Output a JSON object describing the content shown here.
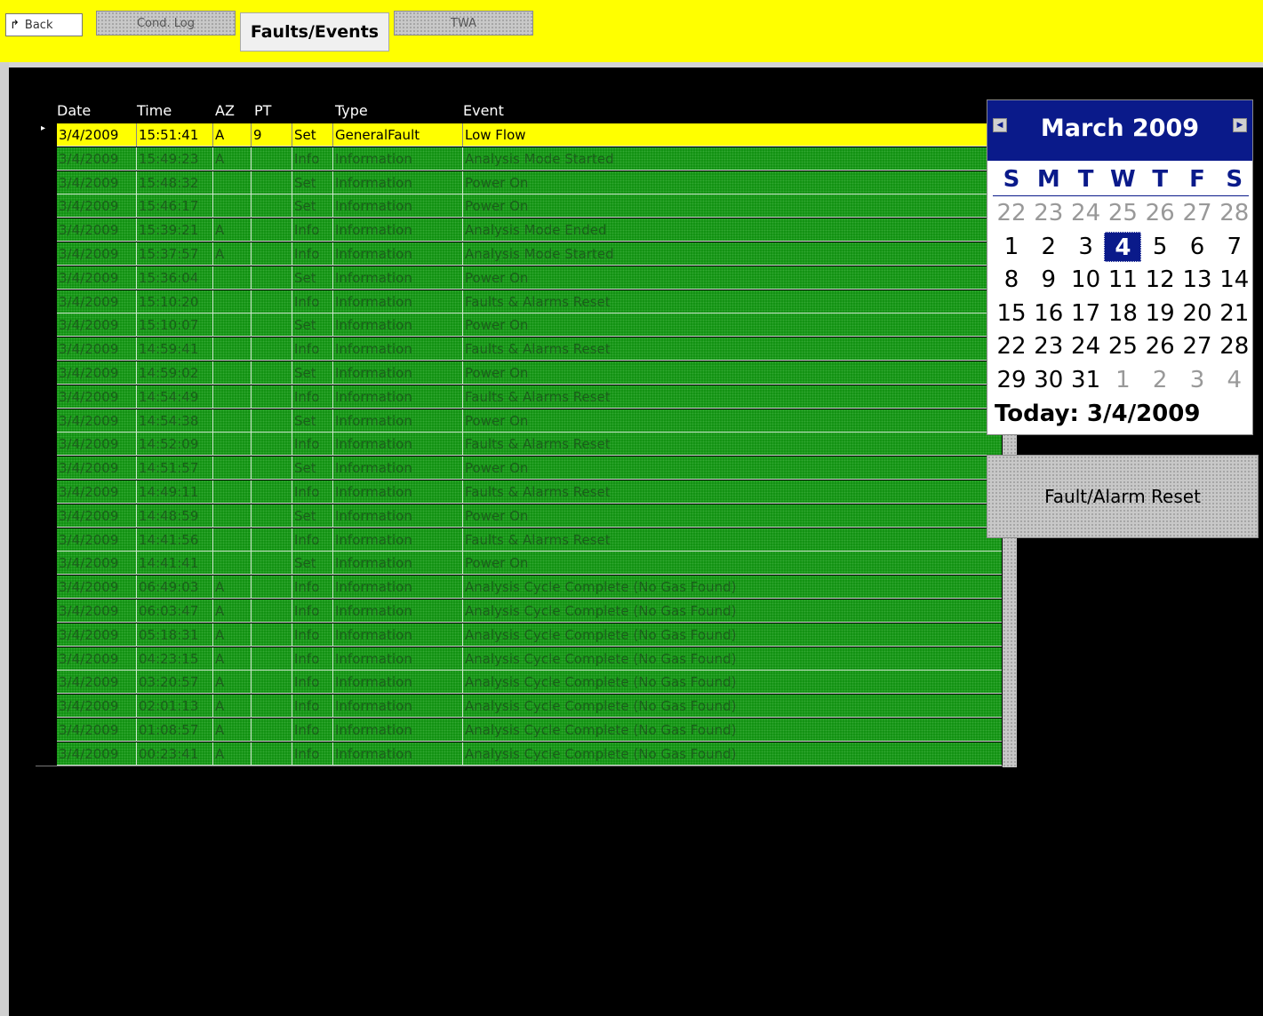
{
  "toolbar": {
    "back_label": "Back",
    "tabs": [
      {
        "label": "Cond. Log",
        "active": false
      },
      {
        "label": "Faults/Events",
        "active": true
      },
      {
        "label": "TWA",
        "active": false
      }
    ]
  },
  "grid": {
    "columns": [
      "Date",
      "Time",
      "AZ",
      "PT",
      "",
      "Type",
      "Event"
    ],
    "rows": [
      {
        "date": "3/4/2009",
        "time": "15:51:41",
        "az": "A",
        "pt": "9",
        "set": "Set",
        "type": "GeneralFault",
        "event": "Low Flow",
        "selected": true
      },
      {
        "date": "3/4/2009",
        "time": "15:49:23",
        "az": "A",
        "pt": "",
        "set": "Info",
        "type": "Information",
        "event": "Analysis Mode Started"
      },
      {
        "date": "3/4/2009",
        "time": "15:48:32",
        "az": "",
        "pt": "",
        "set": "Set",
        "type": "Information",
        "event": "Power On"
      },
      {
        "date": "3/4/2009",
        "time": "15:46:17",
        "az": "",
        "pt": "",
        "set": "Set",
        "type": "Information",
        "event": "Power On"
      },
      {
        "date": "3/4/2009",
        "time": "15:39:21",
        "az": "A",
        "pt": "",
        "set": "Info",
        "type": "Information",
        "event": "Analysis Mode Ended"
      },
      {
        "date": "3/4/2009",
        "time": "15:37:57",
        "az": "A",
        "pt": "",
        "set": "Info",
        "type": "Information",
        "event": "Analysis Mode Started"
      },
      {
        "date": "3/4/2009",
        "time": "15:36:04",
        "az": "",
        "pt": "",
        "set": "Set",
        "type": "Information",
        "event": "Power On"
      },
      {
        "date": "3/4/2009",
        "time": "15:10:20",
        "az": "",
        "pt": "",
        "set": "Info",
        "type": "Information",
        "event": "Faults & Alarms Reset"
      },
      {
        "date": "3/4/2009",
        "time": "15:10:07",
        "az": "",
        "pt": "",
        "set": "Set",
        "type": "Information",
        "event": "Power On"
      },
      {
        "date": "3/4/2009",
        "time": "14:59:41",
        "az": "",
        "pt": "",
        "set": "Info",
        "type": "Information",
        "event": "Faults & Alarms Reset"
      },
      {
        "date": "3/4/2009",
        "time": "14:59:02",
        "az": "",
        "pt": "",
        "set": "Set",
        "type": "Information",
        "event": "Power On"
      },
      {
        "date": "3/4/2009",
        "time": "14:54:49",
        "az": "",
        "pt": "",
        "set": "Info",
        "type": "Information",
        "event": "Faults & Alarms Reset"
      },
      {
        "date": "3/4/2009",
        "time": "14:54:38",
        "az": "",
        "pt": "",
        "set": "Set",
        "type": "Information",
        "event": "Power On"
      },
      {
        "date": "3/4/2009",
        "time": "14:52:09",
        "az": "",
        "pt": "",
        "set": "Info",
        "type": "Information",
        "event": "Faults & Alarms Reset"
      },
      {
        "date": "3/4/2009",
        "time": "14:51:57",
        "az": "",
        "pt": "",
        "set": "Set",
        "type": "Information",
        "event": "Power On"
      },
      {
        "date": "3/4/2009",
        "time": "14:49:11",
        "az": "",
        "pt": "",
        "set": "Info",
        "type": "Information",
        "event": "Faults & Alarms Reset"
      },
      {
        "date": "3/4/2009",
        "time": "14:48:59",
        "az": "",
        "pt": "",
        "set": "Set",
        "type": "Information",
        "event": "Power On"
      },
      {
        "date": "3/4/2009",
        "time": "14:41:56",
        "az": "",
        "pt": "",
        "set": "Info",
        "type": "Information",
        "event": "Faults & Alarms Reset"
      },
      {
        "date": "3/4/2009",
        "time": "14:41:41",
        "az": "",
        "pt": "",
        "set": "Set",
        "type": "Information",
        "event": "Power On"
      },
      {
        "date": "3/4/2009",
        "time": "06:49:03",
        "az": "A",
        "pt": "",
        "set": "Info",
        "type": "Information",
        "event": "Analysis Cycle Complete (No Gas Found)"
      },
      {
        "date": "3/4/2009",
        "time": "06:03:47",
        "az": "A",
        "pt": "",
        "set": "Info",
        "type": "Information",
        "event": "Analysis Cycle Complete (No Gas Found)"
      },
      {
        "date": "3/4/2009",
        "time": "05:18:31",
        "az": "A",
        "pt": "",
        "set": "Info",
        "type": "Information",
        "event": "Analysis Cycle Complete (No Gas Found)"
      },
      {
        "date": "3/4/2009",
        "time": "04:23:15",
        "az": "A",
        "pt": "",
        "set": "Info",
        "type": "Information",
        "event": "Analysis Cycle Complete (No Gas Found)"
      },
      {
        "date": "3/4/2009",
        "time": "03:20:57",
        "az": "A",
        "pt": "",
        "set": "Info",
        "type": "Information",
        "event": "Analysis Cycle Complete (No Gas Found)"
      },
      {
        "date": "3/4/2009",
        "time": "02:01:13",
        "az": "A",
        "pt": "",
        "set": "Info",
        "type": "Information",
        "event": "Analysis Cycle Complete (No Gas Found)"
      },
      {
        "date": "3/4/2009",
        "time": "01:08:57",
        "az": "A",
        "pt": "",
        "set": "Info",
        "type": "Information",
        "event": "Analysis Cycle Complete (No Gas Found)"
      },
      {
        "date": "3/4/2009",
        "time": "00:23:41",
        "az": "A",
        "pt": "",
        "set": "Info",
        "type": "Information",
        "event": "Analysis Cycle Complete (No Gas Found)"
      }
    ]
  },
  "calendar": {
    "title": "March 2009",
    "days_of_week": [
      "S",
      "M",
      "T",
      "W",
      "T",
      "F",
      "S"
    ],
    "weeks": [
      [
        {
          "d": "22",
          "o": true
        },
        {
          "d": "23",
          "o": true
        },
        {
          "d": "24",
          "o": true
        },
        {
          "d": "25",
          "o": true
        },
        {
          "d": "26",
          "o": true
        },
        {
          "d": "27",
          "o": true
        },
        {
          "d": "28",
          "o": true
        }
      ],
      [
        {
          "d": "1"
        },
        {
          "d": "2"
        },
        {
          "d": "3"
        },
        {
          "d": "4",
          "today": true
        },
        {
          "d": "5"
        },
        {
          "d": "6"
        },
        {
          "d": "7"
        }
      ],
      [
        {
          "d": "8"
        },
        {
          "d": "9"
        },
        {
          "d": "10"
        },
        {
          "d": "11"
        },
        {
          "d": "12"
        },
        {
          "d": "13"
        },
        {
          "d": "14"
        }
      ],
      [
        {
          "d": "15"
        },
        {
          "d": "16"
        },
        {
          "d": "17"
        },
        {
          "d": "18"
        },
        {
          "d": "19"
        },
        {
          "d": "20"
        },
        {
          "d": "21"
        }
      ],
      [
        {
          "d": "22"
        },
        {
          "d": "23"
        },
        {
          "d": "24"
        },
        {
          "d": "25"
        },
        {
          "d": "26"
        },
        {
          "d": "27"
        },
        {
          "d": "28"
        }
      ],
      [
        {
          "d": "29"
        },
        {
          "d": "30"
        },
        {
          "d": "31"
        },
        {
          "d": "1",
          "o": true
        },
        {
          "d": "2",
          "o": true
        },
        {
          "d": "3",
          "o": true
        },
        {
          "d": "4",
          "o": true
        }
      ]
    ],
    "today_label": "Today: 3/4/2009"
  },
  "reset_button": {
    "label": "Fault/Alarm Reset"
  },
  "colors": {
    "toolbar": "#ffff00",
    "background": "#000000",
    "row": "#0f8f0f",
    "selected_row": "#ffff00",
    "calendar_header": "#0a1a8a"
  },
  "icons": {
    "back": "back-arrow-icon",
    "prev_month": "prev-month-icon",
    "next_month": "next-month-icon"
  }
}
